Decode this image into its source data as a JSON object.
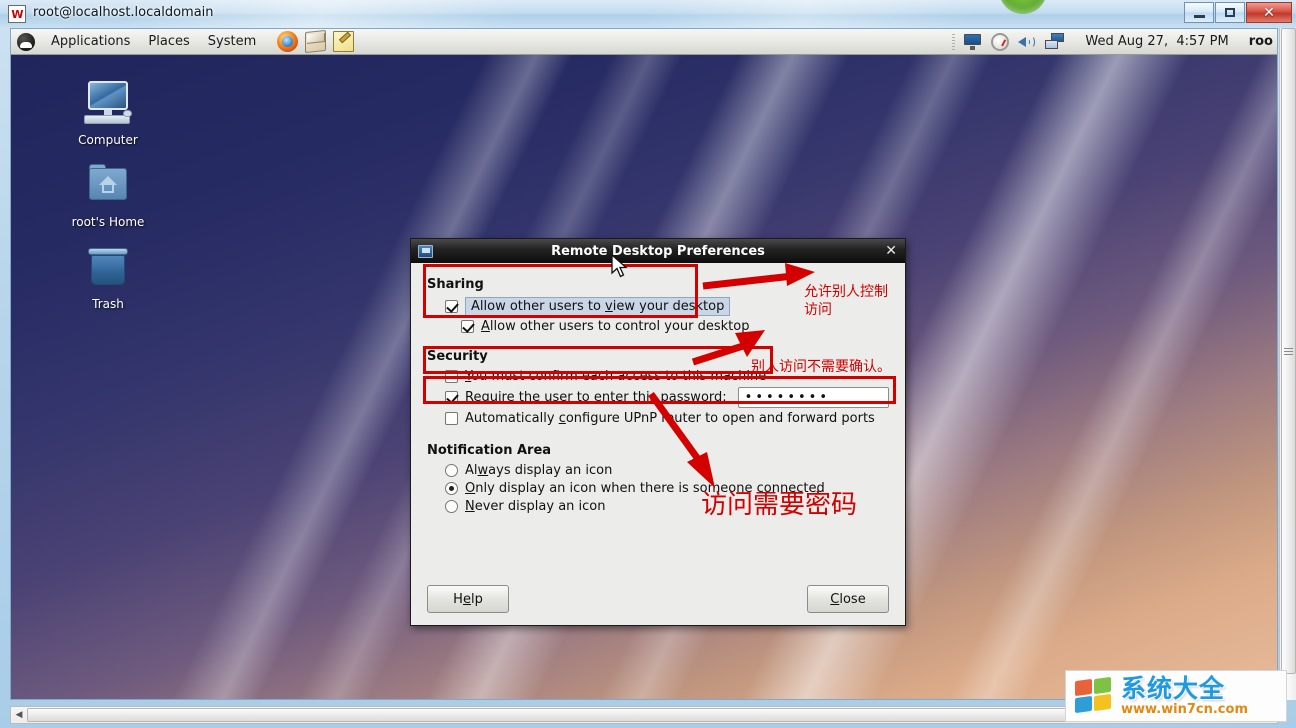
{
  "window": {
    "title": "root@localhost.localdomain",
    "title_icon": "vnc-viewer-icon",
    "minimize_label": "",
    "restore_label": "",
    "close_label": "✕"
  },
  "panel": {
    "logo": "redhat-logo-icon",
    "menus": [
      {
        "label": "Applications",
        "name": "applications-menu"
      },
      {
        "label": "Places",
        "name": "places-menu"
      },
      {
        "label": "System",
        "name": "system-menu"
      }
    ],
    "launchers": [
      {
        "name": "firefox-launcher-icon",
        "title": "Firefox Web Browser"
      },
      {
        "name": "evolution-mail-launcher-icon",
        "title": "Evolution Mail"
      },
      {
        "name": "text-editor-launcher-icon",
        "title": "Text Editor"
      }
    ],
    "tray": [
      {
        "name": "display-icon"
      },
      {
        "name": "gauge-icon"
      },
      {
        "name": "volume-icon"
      },
      {
        "name": "network-icon"
      }
    ],
    "clock": "Wed Aug 27,  4:57 PM",
    "user": "roo"
  },
  "desktop": {
    "icons": [
      {
        "name": "computer-desktop-icon",
        "label": "Computer"
      },
      {
        "name": "home-desktop-icon",
        "label": "root's Home"
      },
      {
        "name": "trash-desktop-icon",
        "label": "Trash"
      }
    ]
  },
  "dialog": {
    "title": "Remote Desktop Preferences",
    "close_label": "✕",
    "sharing": {
      "heading": "Sharing",
      "view_desktop": {
        "label": "Allow other users to ",
        "accel": "v",
        "rest": "iew your desktop",
        "checked": true
      },
      "control_desktop": {
        "pre": "",
        "accel": "A",
        "rest": "llow other users to control your desktop",
        "checked": true
      }
    },
    "security": {
      "heading": "Security",
      "confirm_access": {
        "accel": "Y",
        "rest": "ou must confirm each access to this machine",
        "checked": false
      },
      "require_password": {
        "pre": "",
        "accel": "R",
        "rest": "equire the user to enter this password:",
        "checked": true
      },
      "password_value": "••••••••",
      "password_placeholder": "",
      "upnp": {
        "pre": "Automatically ",
        "accel": "c",
        "rest": "onfigure UPnP router to open and forward ports",
        "checked": false
      }
    },
    "notification": {
      "heading": "Notification Area",
      "options": [
        {
          "pre": "Al",
          "accel": "w",
          "rest": "ays display an icon",
          "selected": false
        },
        {
          "pre": "",
          "accel": "O",
          "rest": "nly display an icon when there is someone connected",
          "selected": true
        },
        {
          "pre": "",
          "accel": "N",
          "rest": "ever display an icon",
          "selected": false
        }
      ]
    },
    "buttons": {
      "help": {
        "pre": "H",
        "accel": "e",
        "rest": "lp"
      },
      "close": {
        "pre": "",
        "accel": "C",
        "rest": "lose"
      }
    }
  },
  "annotations": [
    {
      "name": "annotation-allow-control",
      "text": "允许别人控制\n访问",
      "color": "#d40000"
    },
    {
      "name": "annotation-no-confirm",
      "text": "别人访问不需要确认。",
      "color": "#d40000"
    },
    {
      "name": "annotation-password-required",
      "text": "访问需要密码",
      "color": "#d40000"
    }
  ],
  "watermark": {
    "cn_text": "系统大全",
    "url": "www.win7cn.com",
    "logo": "windows-flag-icon"
  },
  "colors": {
    "annotation_red": "#d40000",
    "dialog_bg": "#ececea",
    "titlebar_dark": "#0d0d0d",
    "highlight_blue": "#c9d6e6"
  }
}
